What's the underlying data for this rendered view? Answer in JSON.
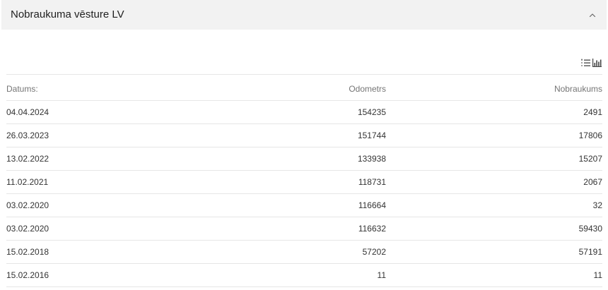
{
  "panel": {
    "title": "Nobraukuma vēsture LV",
    "collapse_icon": "chevron-up-icon"
  },
  "view_toggle": {
    "list_icon": "list-icon",
    "chart_icon": "bar-chart-icon"
  },
  "table": {
    "headers": {
      "date": "Datums:",
      "odometer": "Odometrs",
      "mileage": "Nobraukums"
    },
    "rows": [
      {
        "date": "04.04.2024",
        "odometer": "154235",
        "mileage": "2491"
      },
      {
        "date": "26.03.2023",
        "odometer": "151744",
        "mileage": "17806"
      },
      {
        "date": "13.02.2022",
        "odometer": "133938",
        "mileage": "15207"
      },
      {
        "date": "11.02.2021",
        "odometer": "118731",
        "mileage": "2067"
      },
      {
        "date": "03.02.2020",
        "odometer": "116664",
        "mileage": "32"
      },
      {
        "date": "03.02.2020",
        "odometer": "116632",
        "mileage": "59430"
      },
      {
        "date": "15.02.2018",
        "odometer": "57202",
        "mileage": "57191"
      },
      {
        "date": "15.02.2016",
        "odometer": "11",
        "mileage": "11"
      }
    ]
  },
  "colors": {
    "panel_bg": "#f2f2f2",
    "title_text": "#1f1f1f",
    "border": "#e6e6e6",
    "header_text": "#757575",
    "cell_text": "#333333",
    "icon": "#444444"
  }
}
